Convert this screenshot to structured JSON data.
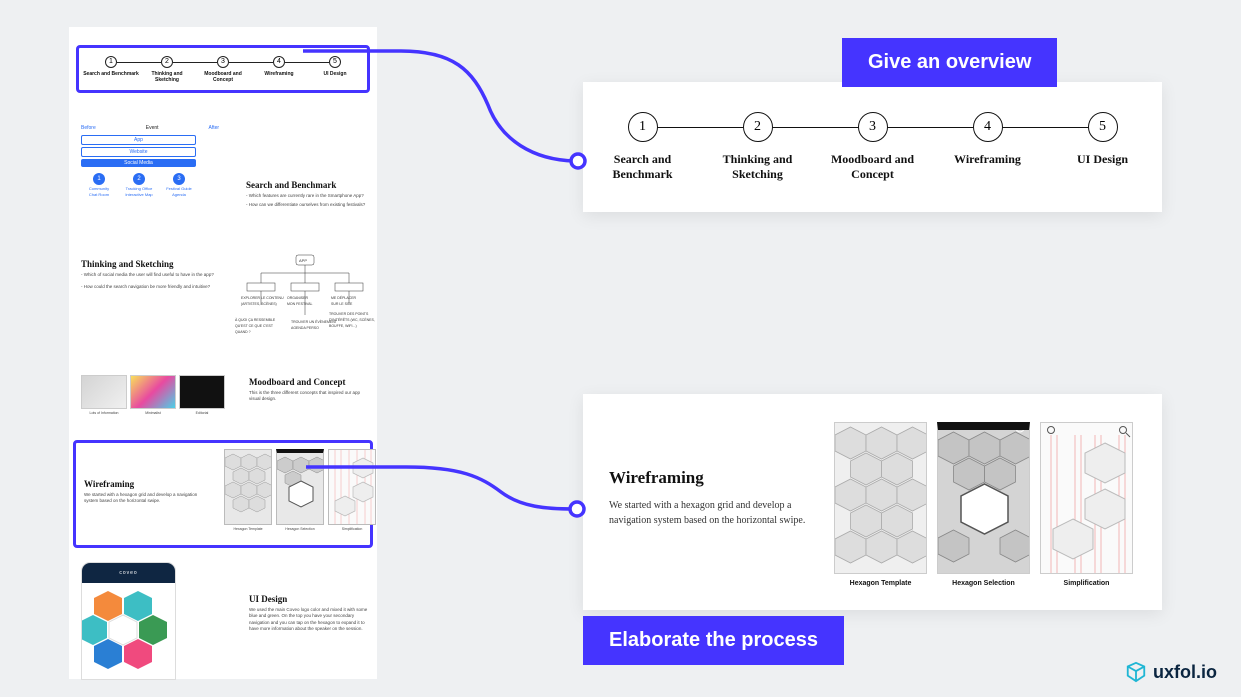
{
  "callouts": {
    "overview": "Give an overview",
    "elaborate": "Elaborate the process"
  },
  "overview_steps": [
    {
      "num": "1",
      "label": "Search and Benchmark"
    },
    {
      "num": "2",
      "label": "Thinking and Sketching"
    },
    {
      "num": "3",
      "label": "Moodboard and Concept"
    },
    {
      "num": "4",
      "label": "Wireframing"
    },
    {
      "num": "5",
      "label": "UI Design"
    }
  ],
  "portfolio": {
    "search": {
      "tabs": [
        "Before",
        "Event",
        "After"
      ],
      "btn_app": "App",
      "btn_website": "Website",
      "btn_social": "Social Media",
      "pills": [
        {
          "num": "1",
          "top": "Community",
          "bot": "Chat Room"
        },
        {
          "num": "2",
          "top": "Tracking Office",
          "bot": "Interactive Map"
        },
        {
          "num": "3",
          "top": "Festival Guide",
          "bot": "Agenda"
        }
      ],
      "heading": "Search and Benchmark",
      "q1": "- Which features are currently rare in the Smartphone App?",
      "q2": "- How can we differentiate ourselves from existing festivals?"
    },
    "think": {
      "heading": "Thinking and Sketching",
      "q1": "- Which of social media the user will find useful to have in the app?",
      "q2": "- How could the search navigation be more friendly and intuitive?"
    },
    "mood": {
      "heading": "Moodboard and Concept",
      "body": "This is the three different concepts that inspired our app visual design.",
      "caps": [
        "Lots of Information",
        "Minimalist",
        "Editorial"
      ]
    },
    "wire": {
      "heading": "Wireframing",
      "body": "We started with a hexagon grid and develop a navigation system based on the horizontal swipe.",
      "caps": [
        "Hexagon Template",
        "Hexagon Selection",
        "Simplification"
      ]
    },
    "ui": {
      "heading": "UI Design",
      "body": "We used the main Coveo logo color and mixed it with some blue and green. On the top you have your secondary navigation and you can tap on the hexagon to expand it to have more information about the speaker on the session.",
      "logo": "coveo"
    }
  },
  "wire_detail": {
    "heading": "Wireframing",
    "body": "We started with a hexagon grid and develop a navigation system based on the horizontal swipe.",
    "caps": [
      "Hexagon Template",
      "Hexagon Selection",
      "Simplification"
    ]
  },
  "logo_text": "uxfol.io"
}
